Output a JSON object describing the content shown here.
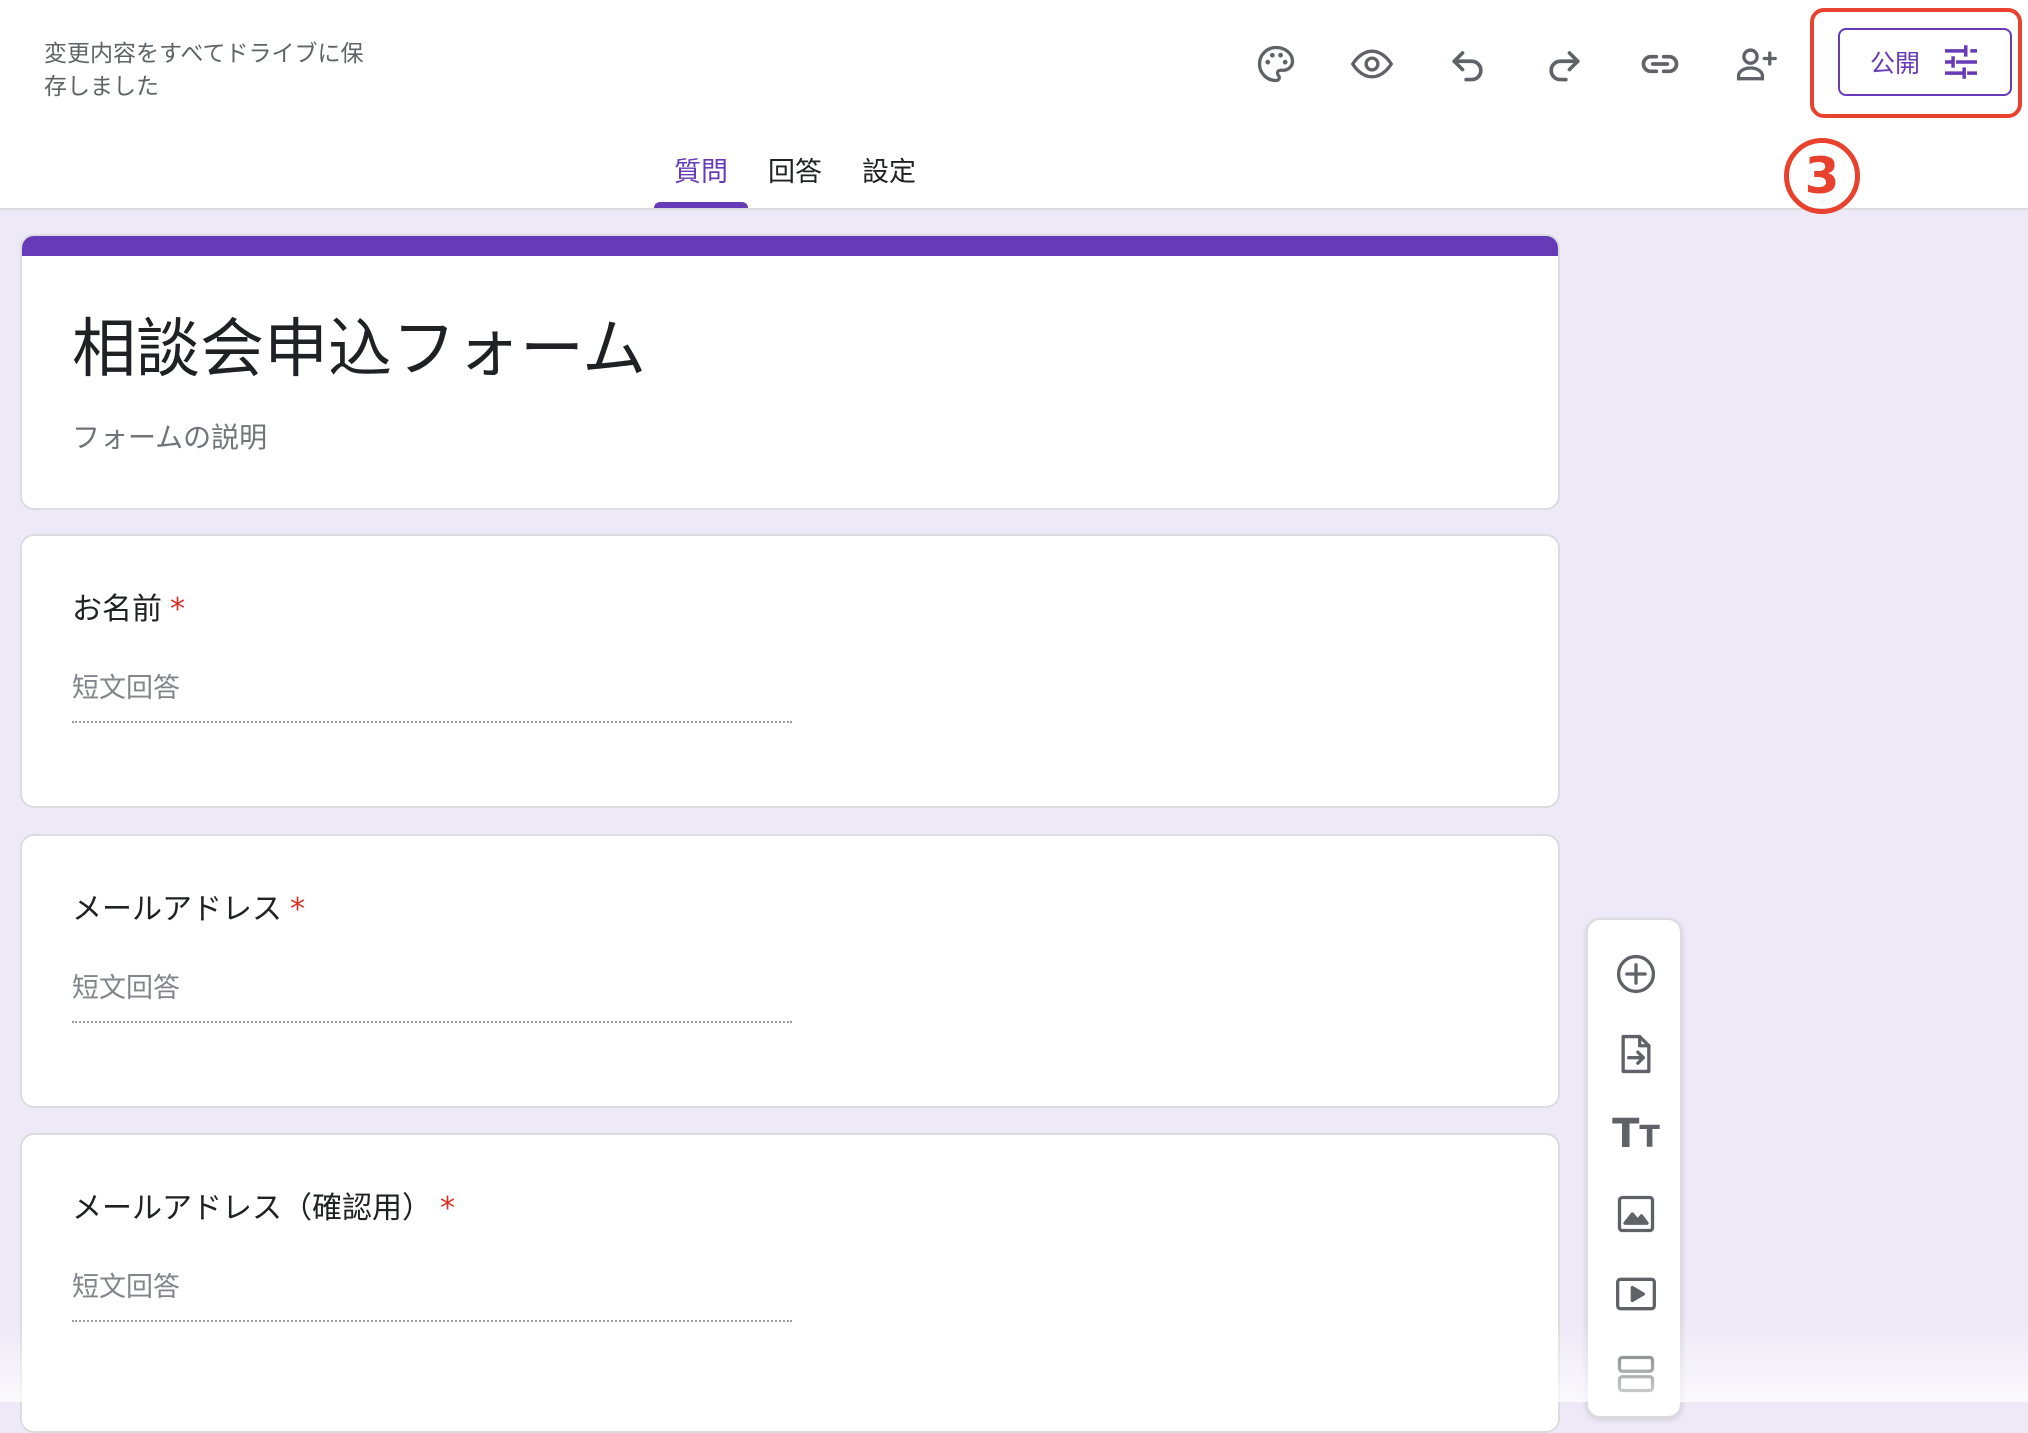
{
  "header": {
    "save_status": "変更内容をすべてドライブに保存しました",
    "publish_label": "公開",
    "step_marker": "3"
  },
  "toolbar_icons": [
    "palette-icon",
    "preview-icon",
    "undo-icon",
    "redo-icon",
    "link-icon",
    "add-collaborator-icon",
    "tune-icon"
  ],
  "tabs": [
    {
      "label": "質問",
      "active": true
    },
    {
      "label": "回答",
      "active": false
    },
    {
      "label": "設定",
      "active": false
    }
  ],
  "form": {
    "title": "相談会申込フォーム",
    "description_placeholder": "フォームの説明"
  },
  "questions": [
    {
      "title": "お名前",
      "required_mark": "*",
      "answer_placeholder": "短文回答"
    },
    {
      "title": "メールアドレス",
      "required_mark": "*",
      "answer_placeholder": "短文回答"
    },
    {
      "title": "メールアドレス（確認用）",
      "required_mark": "*",
      "answer_placeholder": "短文回答"
    }
  ],
  "side_toolbar_icons": [
    "add-question-icon",
    "import-questions-icon",
    "add-title-icon",
    "add-image-icon",
    "add-video-icon",
    "add-section-icon"
  ],
  "colors": {
    "accent": "#673ab7",
    "background": "#ede9f6",
    "required": "#d93025",
    "annotation": "#e8412d"
  }
}
